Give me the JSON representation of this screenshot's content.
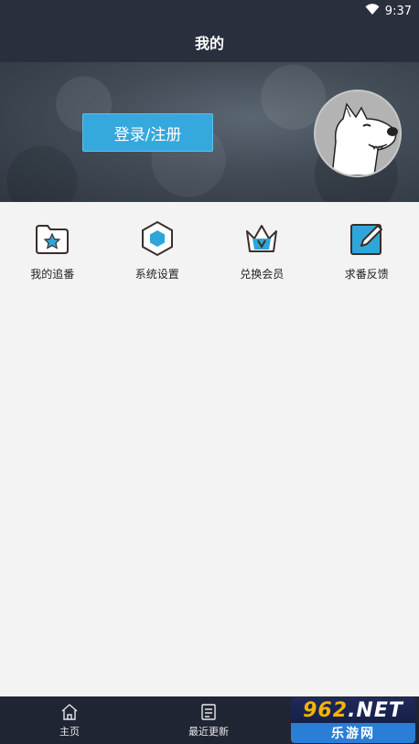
{
  "status_bar": {
    "time": "9:37"
  },
  "header": {
    "title": "我的"
  },
  "banner": {
    "login_label": "登录/注册"
  },
  "menu": [
    {
      "label": "我的追番",
      "icon": "folder-star-icon"
    },
    {
      "label": "系统设置",
      "icon": "hexagon-settings-icon"
    },
    {
      "label": "兑换会员",
      "icon": "crown-vip-icon"
    },
    {
      "label": "求番反馈",
      "icon": "edit-feedback-icon"
    }
  ],
  "bottom_nav": [
    {
      "label": "主页",
      "icon": "home-icon"
    },
    {
      "label": "最近更新",
      "icon": "document-icon"
    }
  ],
  "watermark": {
    "top_num": "962",
    "top_suffix": ".NET",
    "bottom": "乐游网"
  },
  "colors": {
    "header_bg": "#2a2f3d",
    "accent": "#35a8dd",
    "nav_bg": "#1f2533",
    "page_bg": "#f3f3f3"
  }
}
